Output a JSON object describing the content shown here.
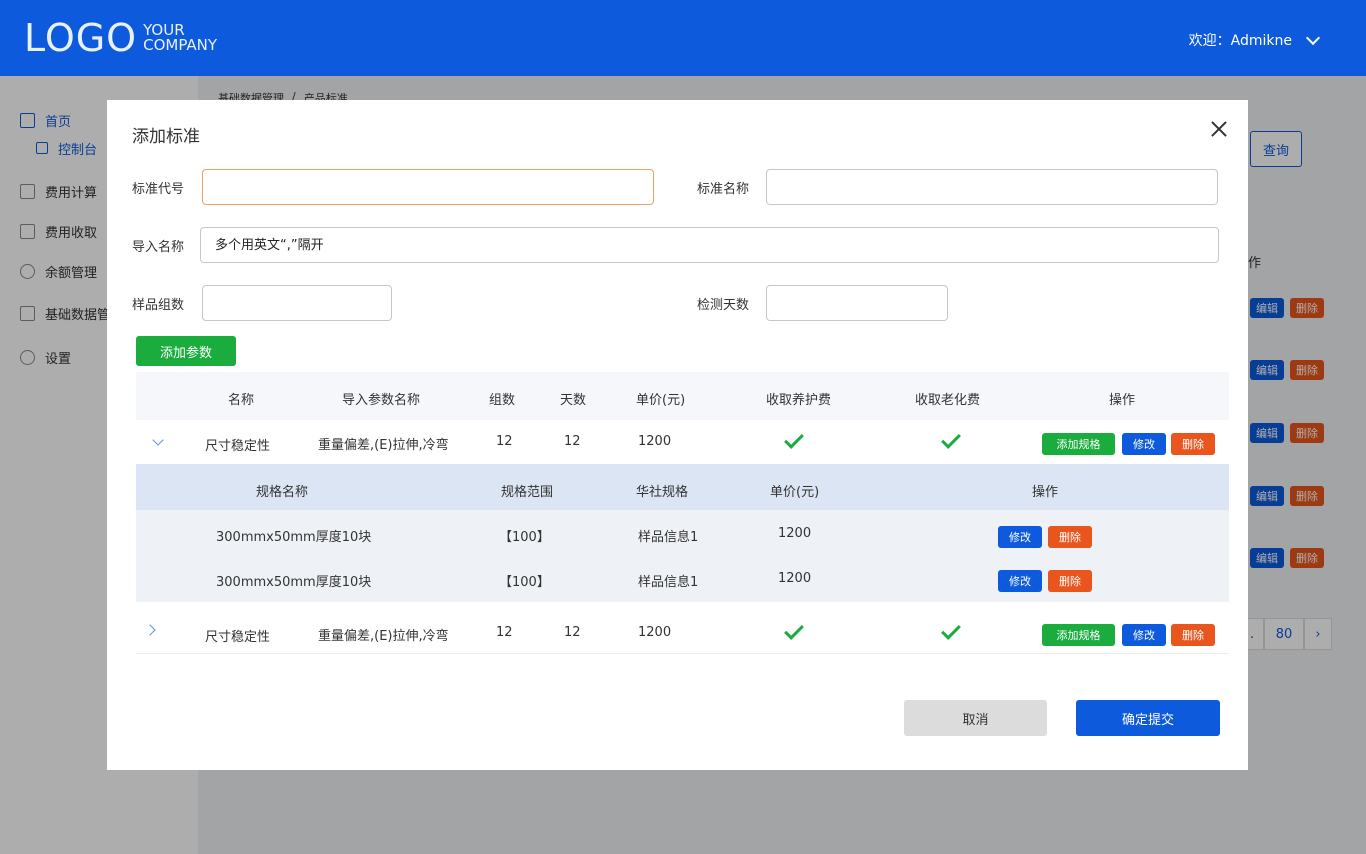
{
  "header": {
    "logo_main": "LOGO",
    "logo_sub_line1": "YOUR",
    "logo_sub_line2": "COMPANY",
    "welcome": "欢迎：Admikne"
  },
  "sidebar": {
    "items": [
      {
        "label": "首页",
        "icon": "home-icon"
      },
      {
        "label": "控制台",
        "icon": "console-icon"
      },
      {
        "label": "费用计算",
        "icon": "calculator-icon"
      },
      {
        "label": "费用收取",
        "icon": "receipt-icon"
      },
      {
        "label": "余额管理",
        "icon": "balance-icon"
      },
      {
        "label": "基础数据管",
        "icon": "chart-icon"
      },
      {
        "label": "设置",
        "icon": "gear-icon"
      }
    ]
  },
  "background": {
    "breadcrumb": [
      "基础数据管理",
      "/",
      "产品标准"
    ],
    "query_button": "查询",
    "op_header": "作",
    "edit": "编辑",
    "delete": "删除",
    "pager": [
      ".",
      "80",
      "›"
    ]
  },
  "modal": {
    "title": "添加标准",
    "fields": {
      "code_label": "标准代号",
      "code_value": "",
      "name_label": "标准名称",
      "name_value": "",
      "import_label": "导入名称",
      "import_placeholder": "多个用英文“,”隔开",
      "samples_label": "样品组数",
      "samples_value": "",
      "days_label": "检测天数",
      "days_value": ""
    },
    "add_param_button": "添加参数",
    "table": {
      "headers": [
        "名称",
        "导入参数名称",
        "组数",
        "天数",
        "单价(元)",
        "收取养护费",
        "收取老化费",
        "操作"
      ],
      "rows": [
        {
          "name": "尺寸稳定性",
          "import_name": "重量偏差,(E)拉伸,冷弯",
          "groups": "12",
          "days": "12",
          "price": "1200",
          "maintenance_fee": true,
          "aging_fee": true,
          "expanded": true
        },
        {
          "name": "尺寸稳定性",
          "import_name": "重量偏差,(E)拉伸,冷弯",
          "groups": "12",
          "days": "12",
          "price": "1200",
          "maintenance_fee": true,
          "aging_fee": true,
          "expanded": false
        }
      ],
      "row_actions": {
        "add_spec": "添加规格",
        "edit": "修改",
        "delete": "删除"
      },
      "sub_headers": [
        "规格名称",
        "规格范围",
        "华社规格",
        "单价(元)",
        "操作"
      ],
      "sub_rows": [
        {
          "spec_name": "300mmx50mm厚度10块",
          "range": "【100】",
          "spec": "样品信息1",
          "price": "1200"
        },
        {
          "spec_name": "300mmx50mm厚度10块",
          "range": "【100】",
          "spec": "样品信息1",
          "price": "1200"
        }
      ]
    },
    "cancel_button": "取消",
    "submit_button": "确定提交"
  }
}
